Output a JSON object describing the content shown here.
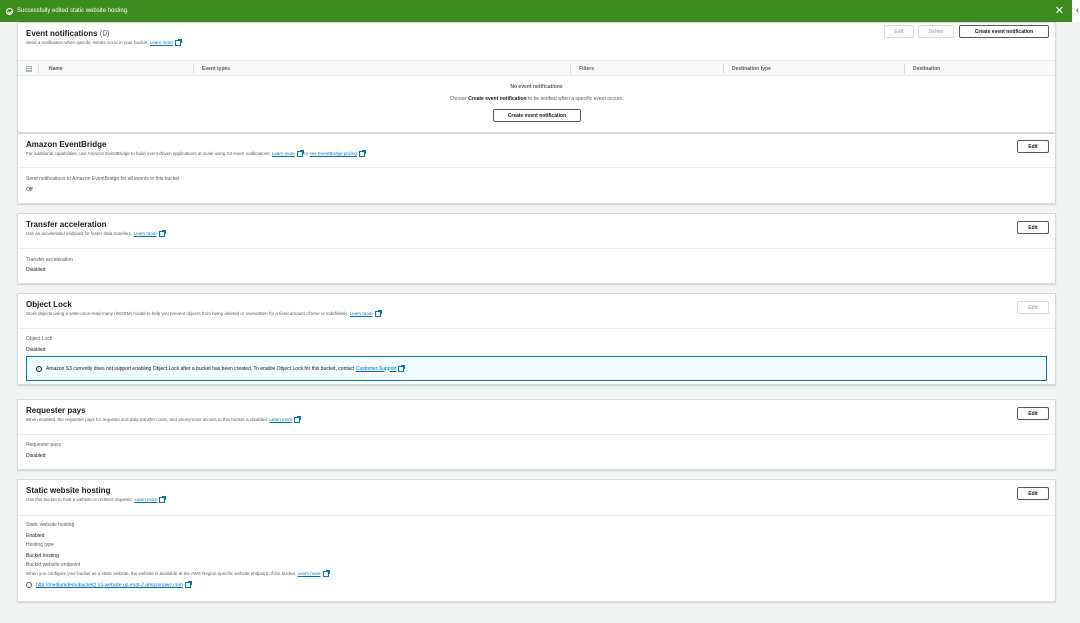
{
  "flash": {
    "message": "Successfully edited static website hosting."
  },
  "event_notifications": {
    "title": "Event notifications",
    "count": "(0)",
    "description": "Send a notification when specific events occur in your bucket.",
    "learn_more": "Learn more",
    "buttons": {
      "edit": "Edit",
      "delete": "Delete",
      "create": "Create event notification"
    },
    "columns": [
      "Name",
      "Event types",
      "Filters",
      "Destination type",
      "Destination"
    ],
    "empty_title": "No event notifications",
    "empty_desc_prefix": "Choose",
    "empty_desc_bold": "Create event notification",
    "empty_desc_suffix": "to be notified when a specific event occurs.",
    "empty_button": "Create event notification"
  },
  "eventbridge": {
    "title": "Amazon EventBridge",
    "description": "For additional capabilities, use Amazon EventBridge to build event-driven applications at scale using S3 event notifications.",
    "learn_more": "Learn more",
    "or": "or",
    "pricing": "see EventBridge pricing",
    "edit": "Edit",
    "label": "Send notifications to Amazon EventBridge for all events in this bucket",
    "value": "Off"
  },
  "transfer_acceleration": {
    "title": "Transfer acceleration",
    "description": "Use an accelerated endpoint for faster data transfers.",
    "learn_more": "Learn more",
    "edit": "Edit",
    "label": "Transfer acceleration",
    "value": "Disabled"
  },
  "object_lock": {
    "title": "Object Lock",
    "description": "Store objects using a write-once-read-many (WORM) model to help you prevent objects from being deleted or overwritten for a fixed amount of time or indefinitely.",
    "learn_more": "Learn more",
    "edit": "Edit",
    "label": "Object Lock",
    "value": "Disabled",
    "info": "Amazon S3 currently does not support enabling Object Lock after a bucket has been created. To enable Object Lock for this bucket, contact",
    "info_link": "Customer Support"
  },
  "requester_pays": {
    "title": "Requester pays",
    "description": "When enabled, the requester pays for requests and data transfer costs, and anonymous access to this bucket is disabled.",
    "learn_more": "Learn more",
    "edit": "Edit",
    "label": "Requester pays",
    "value": "Disabled"
  },
  "static_hosting": {
    "title": "Static website hosting",
    "description": "Use this bucket to host a website or redirect requests.",
    "learn_more": "Learn more",
    "edit": "Edit",
    "label": "Static website hosting",
    "value": "Enabled",
    "type_label": "Hosting type",
    "type_value": "Bucket hosting",
    "endpoint_label": "Bucket website endpoint",
    "endpoint_desc": "When you configure your bucket as a static website, the website is available at the AWS Region-specific website endpoint of the bucket.",
    "endpoint_learn_more": "Learn more",
    "endpoint_url": "http://mediumdemobucket2.s3-website.us-east-2.amazonaws.com"
  }
}
